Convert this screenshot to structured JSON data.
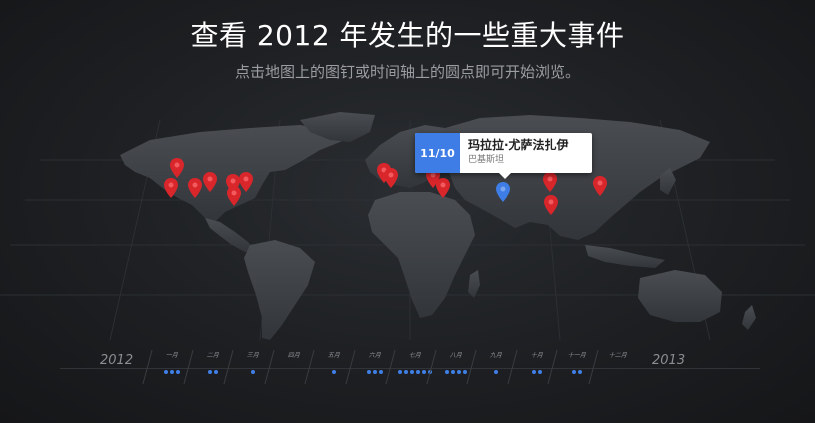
{
  "header": {
    "title": "查看 2012 年发生的一些重大事件",
    "subtitle": "点击地图上的图钉或时间轴上的圆点即可开始浏览。"
  },
  "tooltip": {
    "date": "11/10",
    "event": "玛拉拉·尤萨法扎伊",
    "location": "巴基斯坦"
  },
  "timeline": {
    "start_year": "2012",
    "end_year": "2013",
    "months": [
      {
        "label": "一月",
        "events": 3
      },
      {
        "label": "二月",
        "events": 2
      },
      {
        "label": "三月",
        "events": 1
      },
      {
        "label": "四月",
        "events": 0
      },
      {
        "label": "五月",
        "events": 1
      },
      {
        "label": "六月",
        "events": 3
      },
      {
        "label": "七月",
        "events": 6
      },
      {
        "label": "八月",
        "events": 4
      },
      {
        "label": "九月",
        "events": 1
      },
      {
        "label": "十月",
        "events": 2
      },
      {
        "label": "十一月",
        "events": 2
      },
      {
        "label": "十二月",
        "events": 0
      }
    ]
  },
  "colors": {
    "pin": "#d8262b",
    "active_pin": "#3d7de5",
    "accent": "#3d7de5"
  }
}
